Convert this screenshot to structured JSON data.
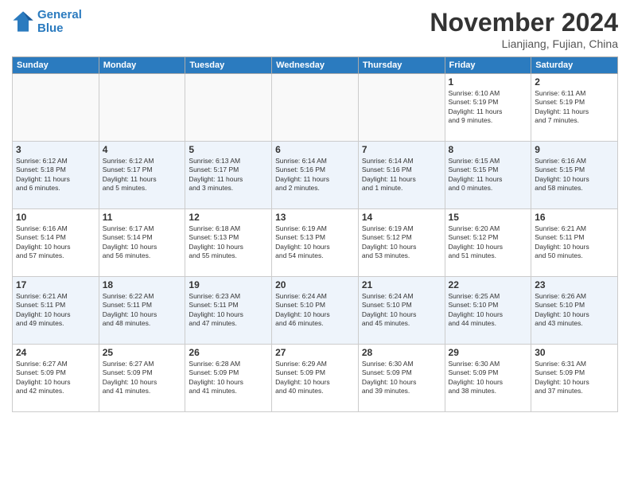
{
  "header": {
    "logo_line1": "General",
    "logo_line2": "Blue",
    "month": "November 2024",
    "location": "Lianjiang, Fujian, China"
  },
  "days_of_week": [
    "Sunday",
    "Monday",
    "Tuesday",
    "Wednesday",
    "Thursday",
    "Friday",
    "Saturday"
  ],
  "weeks": [
    [
      {
        "day": "",
        "info": ""
      },
      {
        "day": "",
        "info": ""
      },
      {
        "day": "",
        "info": ""
      },
      {
        "day": "",
        "info": ""
      },
      {
        "day": "",
        "info": ""
      },
      {
        "day": "1",
        "info": "Sunrise: 6:10 AM\nSunset: 5:19 PM\nDaylight: 11 hours\nand 9 minutes."
      },
      {
        "day": "2",
        "info": "Sunrise: 6:11 AM\nSunset: 5:19 PM\nDaylight: 11 hours\nand 7 minutes."
      }
    ],
    [
      {
        "day": "3",
        "info": "Sunrise: 6:12 AM\nSunset: 5:18 PM\nDaylight: 11 hours\nand 6 minutes."
      },
      {
        "day": "4",
        "info": "Sunrise: 6:12 AM\nSunset: 5:17 PM\nDaylight: 11 hours\nand 5 minutes."
      },
      {
        "day": "5",
        "info": "Sunrise: 6:13 AM\nSunset: 5:17 PM\nDaylight: 11 hours\nand 3 minutes."
      },
      {
        "day": "6",
        "info": "Sunrise: 6:14 AM\nSunset: 5:16 PM\nDaylight: 11 hours\nand 2 minutes."
      },
      {
        "day": "7",
        "info": "Sunrise: 6:14 AM\nSunset: 5:16 PM\nDaylight: 11 hours\nand 1 minute."
      },
      {
        "day": "8",
        "info": "Sunrise: 6:15 AM\nSunset: 5:15 PM\nDaylight: 11 hours\nand 0 minutes."
      },
      {
        "day": "9",
        "info": "Sunrise: 6:16 AM\nSunset: 5:15 PM\nDaylight: 10 hours\nand 58 minutes."
      }
    ],
    [
      {
        "day": "10",
        "info": "Sunrise: 6:16 AM\nSunset: 5:14 PM\nDaylight: 10 hours\nand 57 minutes."
      },
      {
        "day": "11",
        "info": "Sunrise: 6:17 AM\nSunset: 5:14 PM\nDaylight: 10 hours\nand 56 minutes."
      },
      {
        "day": "12",
        "info": "Sunrise: 6:18 AM\nSunset: 5:13 PM\nDaylight: 10 hours\nand 55 minutes."
      },
      {
        "day": "13",
        "info": "Sunrise: 6:19 AM\nSunset: 5:13 PM\nDaylight: 10 hours\nand 54 minutes."
      },
      {
        "day": "14",
        "info": "Sunrise: 6:19 AM\nSunset: 5:12 PM\nDaylight: 10 hours\nand 53 minutes."
      },
      {
        "day": "15",
        "info": "Sunrise: 6:20 AM\nSunset: 5:12 PM\nDaylight: 10 hours\nand 51 minutes."
      },
      {
        "day": "16",
        "info": "Sunrise: 6:21 AM\nSunset: 5:11 PM\nDaylight: 10 hours\nand 50 minutes."
      }
    ],
    [
      {
        "day": "17",
        "info": "Sunrise: 6:21 AM\nSunset: 5:11 PM\nDaylight: 10 hours\nand 49 minutes."
      },
      {
        "day": "18",
        "info": "Sunrise: 6:22 AM\nSunset: 5:11 PM\nDaylight: 10 hours\nand 48 minutes."
      },
      {
        "day": "19",
        "info": "Sunrise: 6:23 AM\nSunset: 5:11 PM\nDaylight: 10 hours\nand 47 minutes."
      },
      {
        "day": "20",
        "info": "Sunrise: 6:24 AM\nSunset: 5:10 PM\nDaylight: 10 hours\nand 46 minutes."
      },
      {
        "day": "21",
        "info": "Sunrise: 6:24 AM\nSunset: 5:10 PM\nDaylight: 10 hours\nand 45 minutes."
      },
      {
        "day": "22",
        "info": "Sunrise: 6:25 AM\nSunset: 5:10 PM\nDaylight: 10 hours\nand 44 minutes."
      },
      {
        "day": "23",
        "info": "Sunrise: 6:26 AM\nSunset: 5:10 PM\nDaylight: 10 hours\nand 43 minutes."
      }
    ],
    [
      {
        "day": "24",
        "info": "Sunrise: 6:27 AM\nSunset: 5:09 PM\nDaylight: 10 hours\nand 42 minutes."
      },
      {
        "day": "25",
        "info": "Sunrise: 6:27 AM\nSunset: 5:09 PM\nDaylight: 10 hours\nand 41 minutes."
      },
      {
        "day": "26",
        "info": "Sunrise: 6:28 AM\nSunset: 5:09 PM\nDaylight: 10 hours\nand 41 minutes."
      },
      {
        "day": "27",
        "info": "Sunrise: 6:29 AM\nSunset: 5:09 PM\nDaylight: 10 hours\nand 40 minutes."
      },
      {
        "day": "28",
        "info": "Sunrise: 6:30 AM\nSunset: 5:09 PM\nDaylight: 10 hours\nand 39 minutes."
      },
      {
        "day": "29",
        "info": "Sunrise: 6:30 AM\nSunset: 5:09 PM\nDaylight: 10 hours\nand 38 minutes."
      },
      {
        "day": "30",
        "info": "Sunrise: 6:31 AM\nSunset: 5:09 PM\nDaylight: 10 hours\nand 37 minutes."
      }
    ]
  ]
}
